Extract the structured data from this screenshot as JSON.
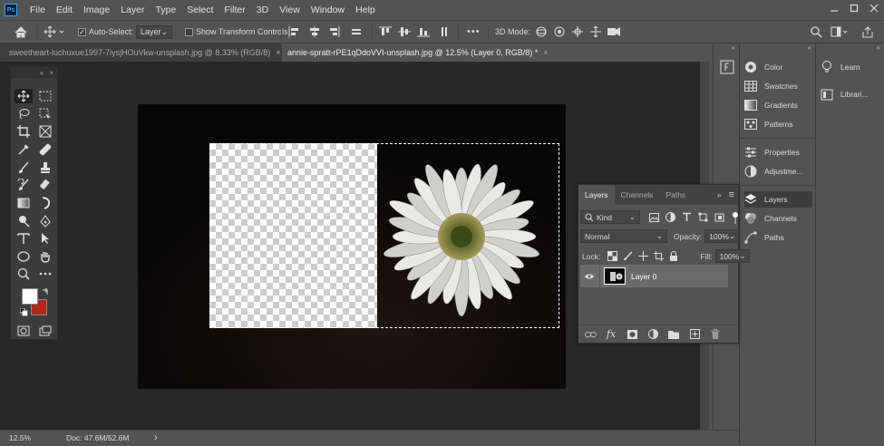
{
  "app": {
    "logo": "Ps"
  },
  "menu": [
    "File",
    "Edit",
    "Image",
    "Layer",
    "Type",
    "Select",
    "Filter",
    "3D",
    "View",
    "Window",
    "Help"
  ],
  "window_controls": [
    "minimize-icon",
    "maximize-icon",
    "close-icon"
  ],
  "options_bar": {
    "auto_select_label": "Auto-Select:",
    "auto_select_target": "Layer",
    "show_transform_label": "Show Transform Controls",
    "more": "•••",
    "mode_3d_label": "3D Mode:"
  },
  "tabs": [
    {
      "label": "sweetheart-luchuxue1997-7iysjHOuVkw-unsplash.jpg @ 8.33% (RGB/8)",
      "active": false
    },
    {
      "label": "annie-spratt-rPE1qDdoVVI-unsplash.jpg @ 12.5% (Layer 0, RGB/8) *",
      "active": true
    }
  ],
  "tab_close": "×",
  "status": {
    "zoom": "12.5%",
    "doc": "Doc: 47.6M/52.6M",
    "arrow": "›"
  },
  "toolbox": {
    "collapse": "«",
    "close": "×",
    "colors": {
      "foreground": "#ffffff",
      "background": "#b2261c"
    }
  },
  "panels_mid": [
    {
      "label": "Color",
      "icon": "color-wheel-icon"
    },
    {
      "label": "Swatches",
      "icon": "swatches-grid-icon"
    },
    {
      "label": "Gradients",
      "icon": "gradient-icon"
    },
    {
      "label": "Patterns",
      "icon": "patterns-icon"
    },
    {
      "label": "Properties",
      "icon": "properties-icon"
    },
    {
      "label": "Adjustme...",
      "icon": "adjustments-icon"
    },
    {
      "label": "Layers",
      "icon": "layers-icon",
      "selected": true
    },
    {
      "label": "Channels",
      "icon": "channels-icon"
    },
    {
      "label": "Paths",
      "icon": "paths-icon"
    }
  ],
  "panels_right": [
    {
      "label": "Learn",
      "icon": "lightbulb-icon"
    },
    {
      "label": "Librari...",
      "icon": "libraries-icon"
    }
  ],
  "collapse_glyph": "«",
  "layers_panel": {
    "tabs": [
      "Layers",
      "Channels",
      "Paths"
    ],
    "expand": "»",
    "menu": "≡",
    "kind": "Kind",
    "blend_mode": "Normal",
    "opacity_label": "Opacity:",
    "opacity_value": "100%",
    "lock_label": "Lock:",
    "fill_label": "Fill:",
    "fill_value": "100%",
    "layers": [
      {
        "name": "Layer 0",
        "visible": true
      }
    ],
    "footer_icons": [
      "link-icon",
      "fx-icon",
      "mask-icon",
      "adjustment-layer-icon",
      "folder-icon",
      "new-layer-icon",
      "trash-icon"
    ],
    "fx_label": "fx"
  }
}
